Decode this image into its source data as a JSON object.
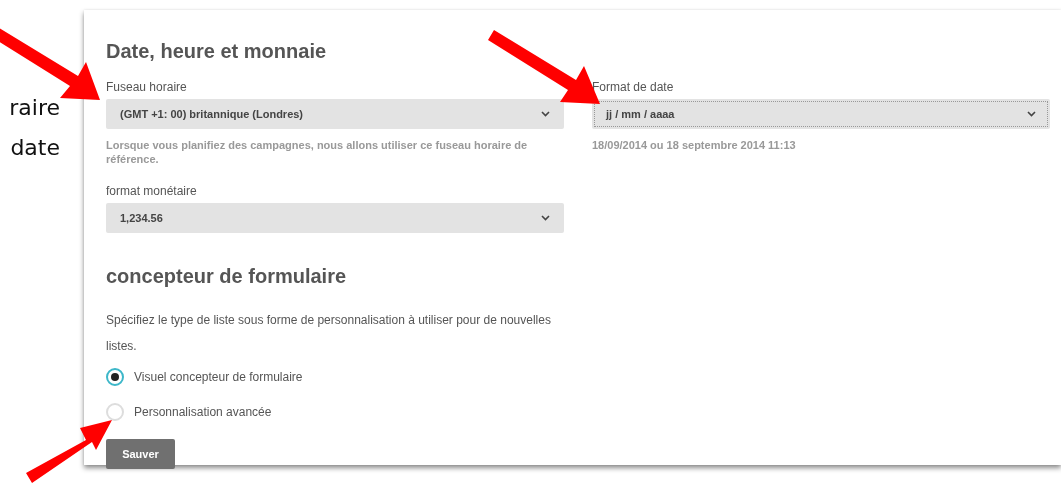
{
  "side_text": [
    "raire",
    "date"
  ],
  "sections": [
    {
      "title": "Date, heure et monnaie"
    },
    {
      "title": "concepteur de formulaire"
    }
  ],
  "fields": {
    "timezone": {
      "label": "Fuseau horaire",
      "value": "(GMT +1: 00) britannique (Londres)",
      "hint": "Lorsque vous planifiez des campagnes, nous allons utiliser ce fuseau horaire de référence.",
      "focused": false
    },
    "date_format": {
      "label": "Format de date",
      "value": "jj / mm / aaaa",
      "hint": "18/09/2014 ou 18 septembre 2014 11:13",
      "focused": true
    },
    "currency": {
      "label": "format monétaire",
      "value": "1,234.56",
      "focused": false
    }
  },
  "form_designer": {
    "description": "Spécifiez le type de liste sous forme de personnalisation à utiliser pour de nouvelles listes.",
    "options": [
      {
        "label": "Visuel concepteur de formulaire",
        "selected": true
      },
      {
        "label": "Personnalisation avancée",
        "selected": false
      }
    ]
  },
  "save_button": "Sauver"
}
